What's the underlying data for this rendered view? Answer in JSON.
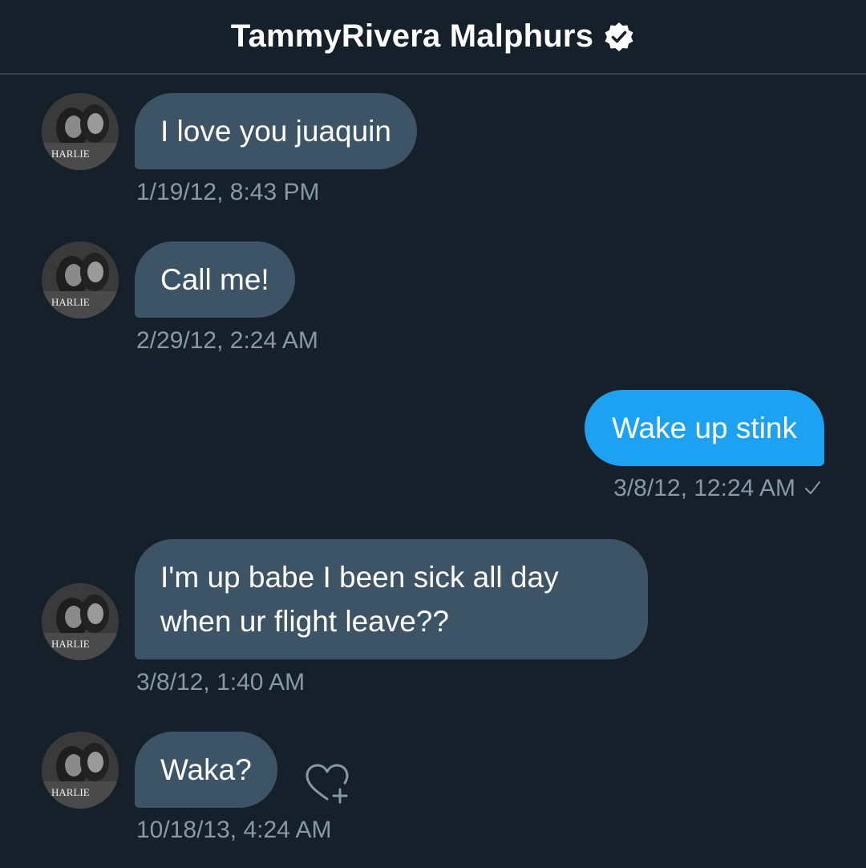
{
  "header": {
    "title": "TammyRivera Malphurs",
    "verified_icon": "verified-badge-icon"
  },
  "avatar": {
    "caption": "HARLIE"
  },
  "messages": [
    {
      "direction": "in",
      "text": "I love you juaquin",
      "time": "1/19/12, 8:43 PM"
    },
    {
      "direction": "in",
      "text": "Call me!",
      "time": "2/29/12, 2:24 AM"
    },
    {
      "direction": "out",
      "text": "Wake up stink",
      "time": "3/8/12, 12:24 AM",
      "status_icon": "check-icon"
    },
    {
      "direction": "in",
      "text": "I'm up babe I been sick all day\nwhen ur flight leave??",
      "time": "3/8/12, 1:40 AM"
    },
    {
      "direction": "in",
      "text": "Waka?",
      "time": "10/18/13, 4:24 AM",
      "action_icon": "heart-plus-icon"
    }
  ],
  "colors": {
    "background": "#15202b",
    "incoming_bubble": "#3d5466",
    "outgoing_bubble": "#1da1f2",
    "timestamp": "#8899a6",
    "divider": "#38444d"
  }
}
